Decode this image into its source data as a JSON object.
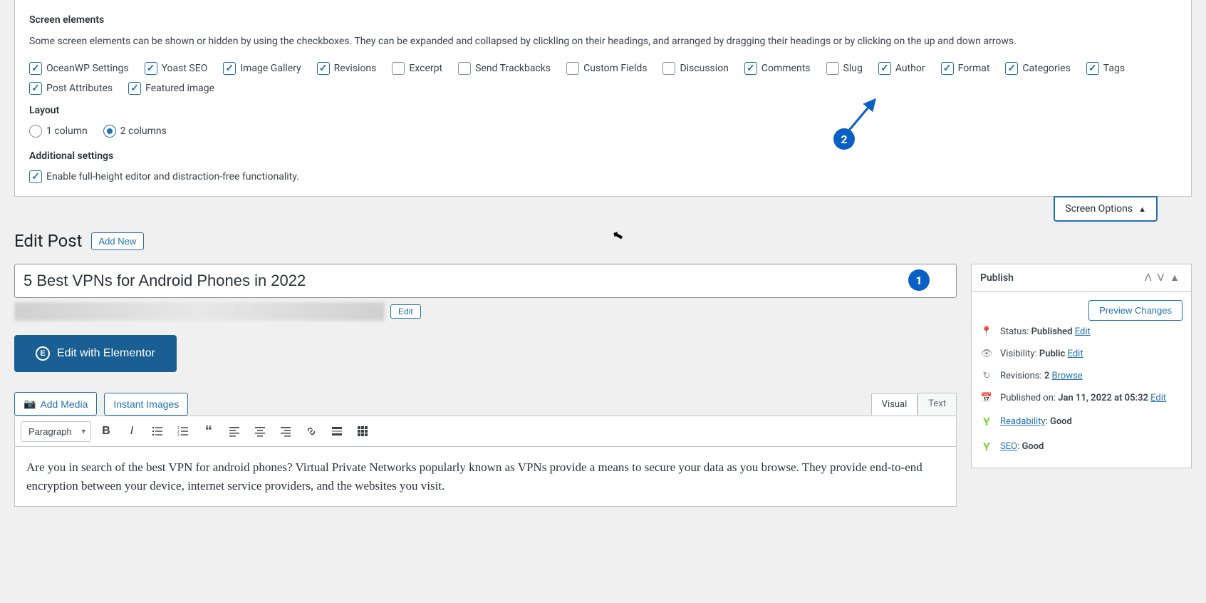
{
  "screenOptions": {
    "heading_elements": "Screen elements",
    "description": "Some screen elements can be shown or hidden by using the checkboxes. They can be expanded and collapsed by clickling on their headings, and arranged by dragging their headings or by clicking on the up and down arrows.",
    "checkboxes": [
      {
        "label": "OceanWP Settings",
        "checked": true
      },
      {
        "label": "Yoast SEO",
        "checked": true
      },
      {
        "label": "Image Gallery",
        "checked": true
      },
      {
        "label": "Revisions",
        "checked": true
      },
      {
        "label": "Excerpt",
        "checked": false
      },
      {
        "label": "Send Trackbacks",
        "checked": false
      },
      {
        "label": "Custom Fields",
        "checked": false
      },
      {
        "label": "Discussion",
        "checked": false
      },
      {
        "label": "Comments",
        "checked": true
      },
      {
        "label": "Slug",
        "checked": false
      },
      {
        "label": "Author",
        "checked": true
      },
      {
        "label": "Format",
        "checked": true
      },
      {
        "label": "Categories",
        "checked": true
      },
      {
        "label": "Tags",
        "checked": true
      },
      {
        "label": "Post Attributes",
        "checked": true
      },
      {
        "label": "Featured image",
        "checked": true
      }
    ],
    "heading_layout": "Layout",
    "layout_options": [
      {
        "label": "1 column",
        "checked": false
      },
      {
        "label": "2 columns",
        "checked": true
      }
    ],
    "heading_additional": "Additional settings",
    "additional_checkbox": {
      "label": "Enable full-height editor and distraction-free functionality.",
      "checked": true
    },
    "tab_label": "Screen Options"
  },
  "pageTitle": "Edit Post",
  "addNew": "Add New",
  "postTitle": "5 Best VPNs for Android Phones in 2022",
  "permalinkEdit": "Edit",
  "elementorBtn": "Edit with Elementor",
  "addMedia": "Add Media",
  "instantImages": "Instant Images",
  "editorTabs": {
    "visual": "Visual",
    "text": "Text"
  },
  "formatSelect": "Paragraph",
  "editorContent": "Are you in search of the best VPN for android phones? Virtual Private Networks popularly known as VPNs provide a means to secure your data as you browse. They provide end-to-end encryption between your device, internet service providers, and the websites you visit.",
  "publishBox": {
    "title": "Publish",
    "preview": "Preview Changes",
    "status_label": "Status:",
    "status_value": "Published",
    "status_edit": "Edit",
    "visibility_label": "Visibility:",
    "visibility_value": "Public",
    "visibility_edit": "Edit",
    "revisions_label": "Revisions:",
    "revisions_value": "2",
    "revisions_browse": "Browse",
    "published_label": "Published on:",
    "published_value": "Jan 11, 2022 at 05:32",
    "published_edit": "Edit",
    "readability_label": "Readability",
    "readability_value": "Good",
    "seo_label": "SEO",
    "seo_value": "Good"
  },
  "badges": {
    "one": "1",
    "two": "2"
  }
}
